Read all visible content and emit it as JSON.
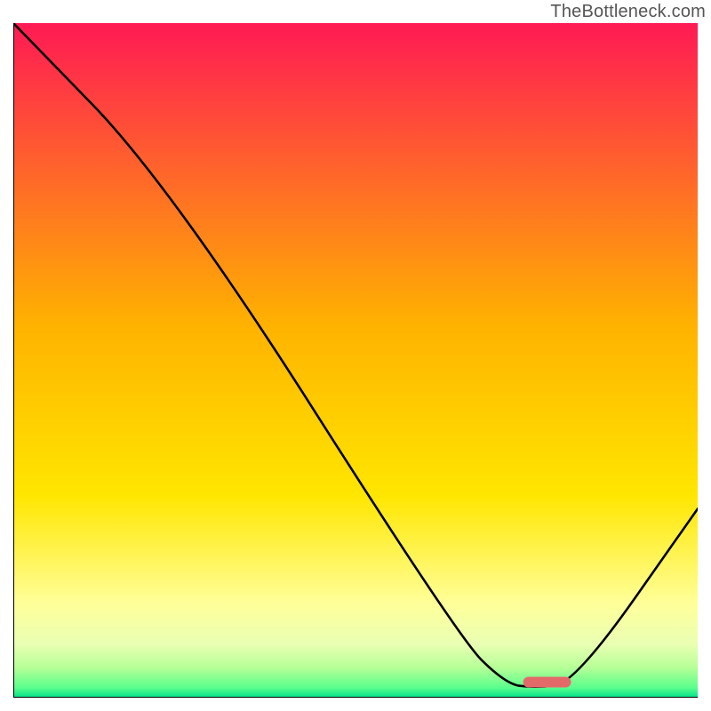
{
  "watermark": {
    "text": "TheBottleneck.com"
  },
  "chart_data": {
    "type": "line",
    "title": "",
    "xlabel": "",
    "ylabel": "",
    "xlim": [
      0,
      100
    ],
    "ylim": [
      0,
      100
    ],
    "grid": false,
    "legend": false,
    "gradient_bands": [
      {
        "stop": 0.0,
        "color": "#ff1a54"
      },
      {
        "stop": 0.45,
        "color": "#ffb300"
      },
      {
        "stop": 0.7,
        "color": "#ffe600"
      },
      {
        "stop": 0.86,
        "color": "#ffff99"
      },
      {
        "stop": 0.92,
        "color": "#eaffb3"
      },
      {
        "stop": 0.955,
        "color": "#b7ff97"
      },
      {
        "stop": 0.985,
        "color": "#5cff8d"
      },
      {
        "stop": 1.0,
        "color": "#00e08a"
      }
    ],
    "series": [
      {
        "name": "bottleneck-curve",
        "stroke": "#000000",
        "points": [
          {
            "x": 0,
            "y": 100
          },
          {
            "x": 23,
            "y": 76
          },
          {
            "x": 65,
            "y": 9
          },
          {
            "x": 72,
            "y": 2
          },
          {
            "x": 76,
            "y": 1.5
          },
          {
            "x": 82,
            "y": 2
          },
          {
            "x": 100,
            "y": 28
          }
        ]
      }
    ],
    "marker": {
      "x_center": 78,
      "x_halfwidth": 3.5,
      "y": 2.3,
      "color": "#e46a6a"
    }
  }
}
